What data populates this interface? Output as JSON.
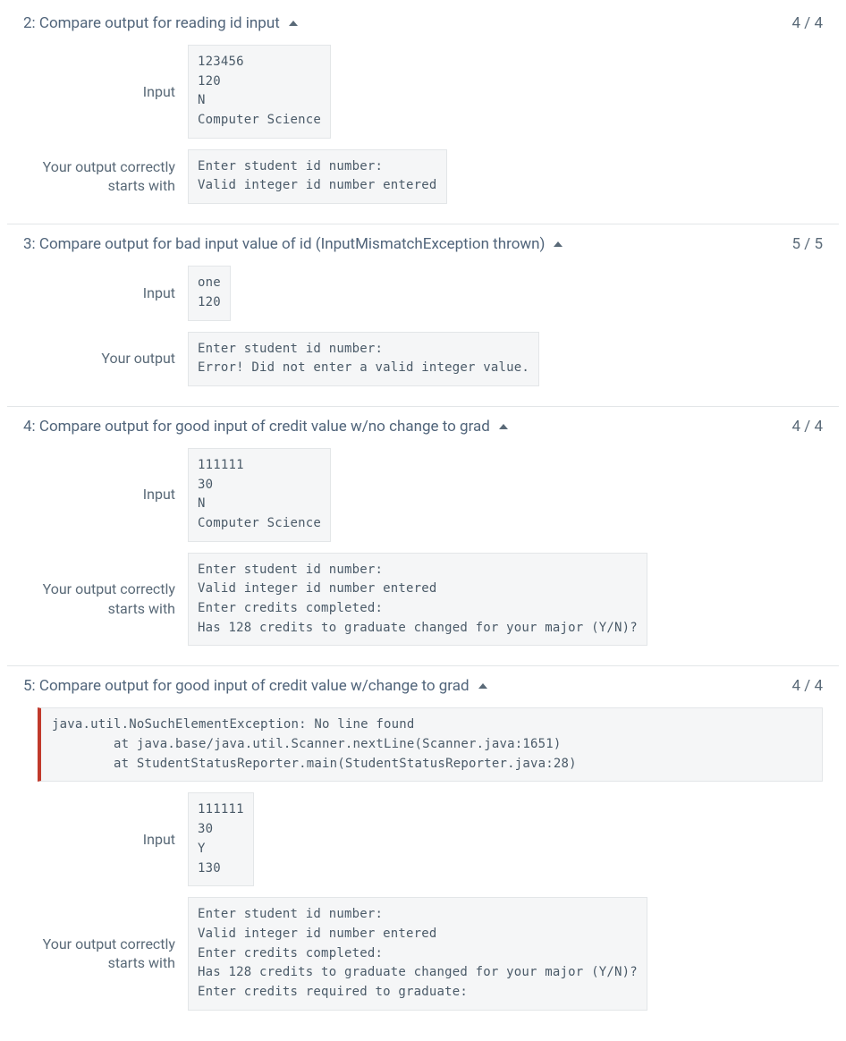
{
  "tests": [
    {
      "title": "2: Compare output for reading id input",
      "score": "4 / 4",
      "error": null,
      "rows": [
        {
          "label": "Input",
          "text": "123456\n120\nN\nComputer Science"
        },
        {
          "label": "Your output correctly starts with",
          "text": "Enter student id number:\nValid integer id number entered"
        }
      ]
    },
    {
      "title": "3: Compare output for bad input value of id (InputMismatchException  thrown)",
      "score": "5 / 5",
      "error": null,
      "rows": [
        {
          "label": "Input",
          "text": "one\n120"
        },
        {
          "label": "Your output",
          "text": "Enter student id number:\nError! Did not enter a valid integer value."
        }
      ]
    },
    {
      "title": "4: Compare output for good input of credit value w/no change to grad",
      "score": "4 / 4",
      "error": null,
      "rows": [
        {
          "label": "Input",
          "text": "111111\n30\nN\nComputer Science"
        },
        {
          "label": "Your output correctly starts with",
          "text": "Enter student id number:\nValid integer id number entered\nEnter credits completed:\nHas 128 credits to graduate changed for your major (Y/N)?"
        }
      ]
    },
    {
      "title": "5: Compare output for good input of credit value w/change to grad",
      "score": "4 / 4",
      "error": "java.util.NoSuchElementException: No line found\n        at java.base/java.util.Scanner.nextLine(Scanner.java:1651)\n        at StudentStatusReporter.main(StudentStatusReporter.java:28)",
      "rows": [
        {
          "label": "Input",
          "text": "111111\n30\nY\n130"
        },
        {
          "label": "Your output correctly starts with",
          "text": "Enter student id number:\nValid integer id number entered\nEnter credits completed:\nHas 128 credits to graduate changed for your major (Y/N)?\nEnter credits required to graduate:"
        }
      ]
    }
  ]
}
